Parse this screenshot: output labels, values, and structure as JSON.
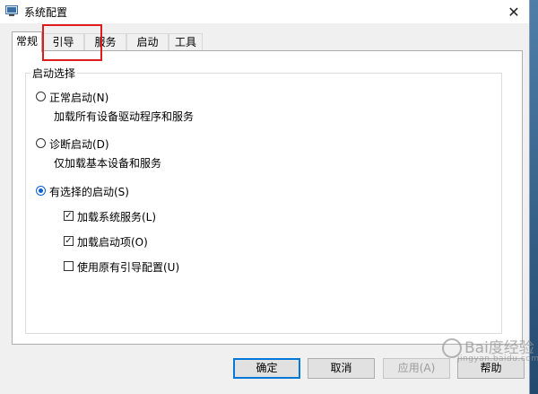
{
  "window": {
    "title": "系统配置",
    "close_glyph": "✕"
  },
  "tabs": [
    {
      "label": "常规",
      "active": true
    },
    {
      "label": "引导",
      "active": false
    },
    {
      "label": "服务",
      "active": false
    },
    {
      "label": "启动",
      "active": false
    },
    {
      "label": "工具",
      "active": false
    }
  ],
  "startup_group": {
    "legend": "启动选择",
    "normal": {
      "label": "正常启动(N)",
      "description": "加载所有设备驱动程序和服务",
      "checked": false
    },
    "diagnostic": {
      "label": "诊断启动(D)",
      "description": "仅加载基本设备和服务",
      "checked": false
    },
    "selective": {
      "label": "有选择的启动(S)",
      "checked": true,
      "options": [
        {
          "label": "加载系统服务(L)",
          "checked": true
        },
        {
          "label": "加载启动项(O)",
          "checked": true
        },
        {
          "label": "使用原有引导配置(U)",
          "checked": false
        }
      ]
    }
  },
  "buttons": {
    "ok": "确定",
    "cancel": "取消",
    "apply": "应用(A)",
    "help": "帮助"
  },
  "watermark": {
    "text": "Bai度经验",
    "sub": "jingyan.baidu.com"
  },
  "colors": {
    "highlight": "#e01b1b",
    "accent": "#0078d7"
  }
}
